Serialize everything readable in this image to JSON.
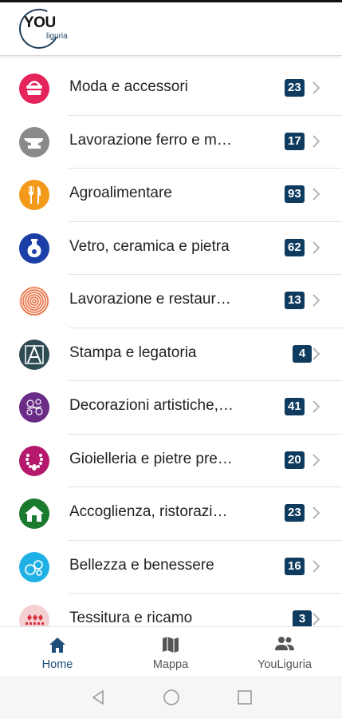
{
  "header": {
    "logo_you": "YOU",
    "logo_liguria": "liguria"
  },
  "categories": [
    {
      "label": "Moda e accessori",
      "count": "23",
      "icon": "handbag-icon",
      "color": "#e6245c"
    },
    {
      "label": "Lavorazione ferro e m…",
      "count": "17",
      "icon": "anvil-icon",
      "color": "#8a8a8a"
    },
    {
      "label": "Agroalimentare",
      "count": "93",
      "icon": "fork-knife-icon",
      "color": "#f39a1b"
    },
    {
      "label": "Vetro, ceramica e pietra",
      "count": "62",
      "icon": "vase-icon",
      "color": "#1b3fa6"
    },
    {
      "label": "Lavorazione e restaur…",
      "count": "13",
      "icon": "wood-rings-icon",
      "color": "#e8643a"
    },
    {
      "label": "Stampa e legatoria",
      "count": "4",
      "icon": "print-letter-icon",
      "color": "#2e4a52"
    },
    {
      "label": "Decorazioni artistiche,…",
      "count": "41",
      "icon": "floral-pattern-icon",
      "color": "#6a2c87"
    },
    {
      "label": "Gioielleria e pietre pre…",
      "count": "20",
      "icon": "necklace-icon",
      "color": "#b5196b"
    },
    {
      "label": "Accoglienza, ristorazi…",
      "count": "23",
      "icon": "house-icon",
      "color": "#1a7a2e"
    },
    {
      "label": "Bellezza e benessere",
      "count": "16",
      "icon": "bubbles-icon",
      "color": "#1fb1e6"
    },
    {
      "label": "Tessitura e ricamo",
      "count": "3",
      "icon": "embroidery-icon",
      "color": "#d8313b"
    }
  ],
  "tabs": [
    {
      "label": "Home",
      "icon": "home-icon",
      "active": true
    },
    {
      "label": "Mappa",
      "icon": "map-icon",
      "active": false
    },
    {
      "label": "YouLiguria",
      "icon": "people-icon",
      "active": false
    }
  ],
  "colors": {
    "badge": "#0f3b5f",
    "active_tab": "#1f4e79"
  }
}
